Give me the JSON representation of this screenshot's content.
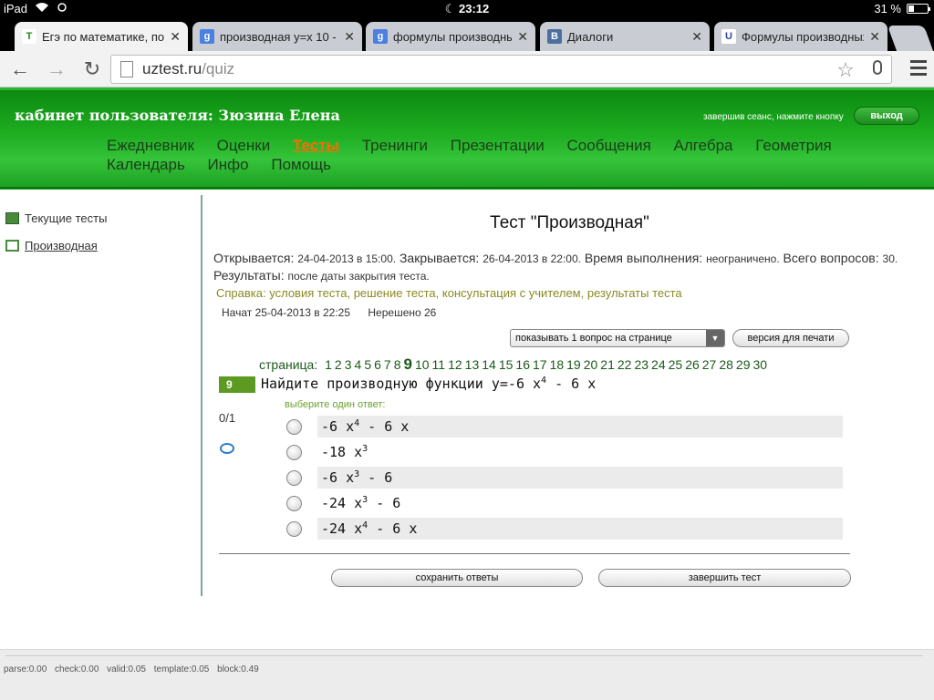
{
  "status_bar": {
    "device": "iPad",
    "time": "23:12",
    "battery": "31 %",
    "battery_level": 0.31
  },
  "tabs": [
    {
      "title": "Егэ по математике, подг",
      "favicon": "T",
      "favicon_color": "#1a8a1a"
    },
    {
      "title": "производная y=x 10 - По",
      "favicon": "g",
      "favicon_color": "#4a80e0"
    },
    {
      "title": "формулы производных -",
      "favicon": "g",
      "favicon_color": "#4a80e0"
    },
    {
      "title": "Диалоги",
      "favicon": "B",
      "favicon_color": "#4a6fa0"
    },
    {
      "title": "Формулы производных -",
      "favicon": "U",
      "favicon_color": "#2a4a9a"
    }
  ],
  "address_bar": {
    "host": "uztest.ru",
    "path": "/quiz"
  },
  "header": {
    "cabinet": "кабинет пользователя: Зюзина Елена",
    "logout_hint": "завершив сеанс, нажмите кнопку",
    "logout_button": "выход",
    "nav": [
      "Ежедневник",
      "Оценки",
      "Тесты",
      "Тренинги",
      "Презентации",
      "Сообщения",
      "Алгебра",
      "Геометрия",
      "Календарь",
      "Инфо",
      "Помощь"
    ],
    "active_nav": "Тесты"
  },
  "sidebar": {
    "items": [
      {
        "label": "Текущие тесты"
      },
      {
        "label": "Производная"
      }
    ]
  },
  "test": {
    "title": "Тест \"Производная\"",
    "opens_label": "Открывается:",
    "opens_value": "24-04-2013 в 15:00.",
    "closes_label": "Закрывается:",
    "closes_value": "26-04-2013 в 22:00.",
    "duration_label": "Время выполнения:",
    "duration_value": "неограниченo.",
    "total_label": "Всего вопросов:",
    "total_value": "30.",
    "results_label": "Результаты:",
    "results_value": "после даты закрытия теста.",
    "help_label": "Справка:",
    "help_links": [
      "условия теста,",
      "решение теста,",
      "консультация с учителем,",
      "результаты теста"
    ],
    "started": "Начат 25-04-2013 в 22:25",
    "unsolved": "Нерешено 26",
    "per_page_select": "показывать 1 вопрос на странице",
    "print_button": "версия для печати",
    "page_label": "страница:",
    "page_count": 30,
    "current_page": 9,
    "question_number": "9",
    "question_text": "Найдите производную функции y=-6 x",
    "question_exp": "4",
    "question_tail": "- 6 x",
    "choose_label": "выберите один ответ:",
    "score": "0/1",
    "answers": [
      {
        "a": "-6 x",
        "exp": "4",
        "b": " - 6 x"
      },
      {
        "a": "-18 x",
        "exp": "3",
        "b": ""
      },
      {
        "a": "-6 x",
        "exp": "3",
        "b": " - 6"
      },
      {
        "a": "-24 x",
        "exp": "3",
        "b": " - 6"
      },
      {
        "a": "-24 x",
        "exp": "4",
        "b": " - 6 x"
      }
    ],
    "save_button": "сохранить ответы",
    "finish_button": "завершить тест"
  },
  "footer": {
    "stats": "parse:0.00 check:0.00 valid:0.05 template:0.05 block:0.49"
  },
  "colors": {
    "header_green": "#1fae22",
    "active_nav": "#ff6a00",
    "page_link": "#1a5a1a"
  }
}
